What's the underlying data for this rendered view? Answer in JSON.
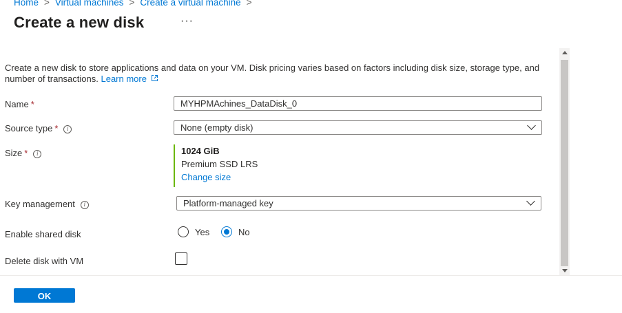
{
  "breadcrumb": {
    "items": [
      "Home",
      "Virtual machines",
      "Create a virtual machine"
    ],
    "separator": ">"
  },
  "page": {
    "title": "Create a new disk",
    "more": "···"
  },
  "description": {
    "text": "Create a new disk to store applications and data on your VM. Disk pricing varies based on factors including disk size, storage type, and number of transactions.",
    "link": "Learn more"
  },
  "form": {
    "name": {
      "label": "Name",
      "required": "*",
      "value": "MYHPMAchines_DataDisk_0"
    },
    "source_type": {
      "label": "Source type",
      "required": "*",
      "value": "None (empty disk)"
    },
    "size": {
      "label": "Size",
      "required": "*",
      "size": "1024 GiB",
      "sku": "Premium SSD LRS",
      "change_link": "Change size"
    },
    "key_management": {
      "label": "Key management",
      "value": "Platform-managed key"
    },
    "shared_disk": {
      "label": "Enable shared disk",
      "options": [
        "Yes",
        "No"
      ],
      "selected": "No"
    },
    "delete_with_vm": {
      "label": "Delete disk with VM",
      "checked": false
    }
  },
  "footer": {
    "ok_label": "OK"
  },
  "colors": {
    "accent": "#0078d4",
    "required": "#a4262c",
    "size_bar": "#6bb700"
  },
  "icons": [
    "info-icon",
    "external-link-icon",
    "chevron-down-icon",
    "scroll-up-icon",
    "scroll-down-icon"
  ]
}
